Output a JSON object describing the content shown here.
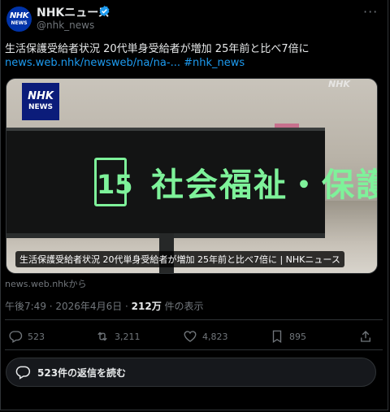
{
  "post": {
    "author_name": "NHKニュース",
    "handle": "@nhk_news",
    "avatar_text_top": "NHK",
    "avatar_text_bottom": "NEWS",
    "text": "生活保護受給者状況 20代単身受給者が増加 25年前と比べ7倍に",
    "link": "news.web.nhk/newsweb/na/na-...",
    "hashtag": "#nhk_news",
    "source": "news.web.nhkから",
    "time": "午後7:49 · 2026年4月6日 · ",
    "views_count": "212万",
    "views_label": " 件の表示"
  },
  "media": {
    "logo_top": "NHK",
    "logo_bottom": "NEWS",
    "watermark": "NHK",
    "sign_number": "15",
    "sign_text": "社会福祉・保護",
    "caption": "生活保護受給者状況 20代単身受給者が増加 25年前と比べ7倍に | NHKニュース"
  },
  "actions": {
    "replies": "523",
    "reposts": "3,211",
    "likes": "4,823",
    "bookmarks": "895"
  },
  "read_replies_label": "523件の返信を読む",
  "colors": {
    "accent": "#1d9bf0",
    "verified": "#1d9bf0",
    "sign_green": "#7ef29a"
  }
}
